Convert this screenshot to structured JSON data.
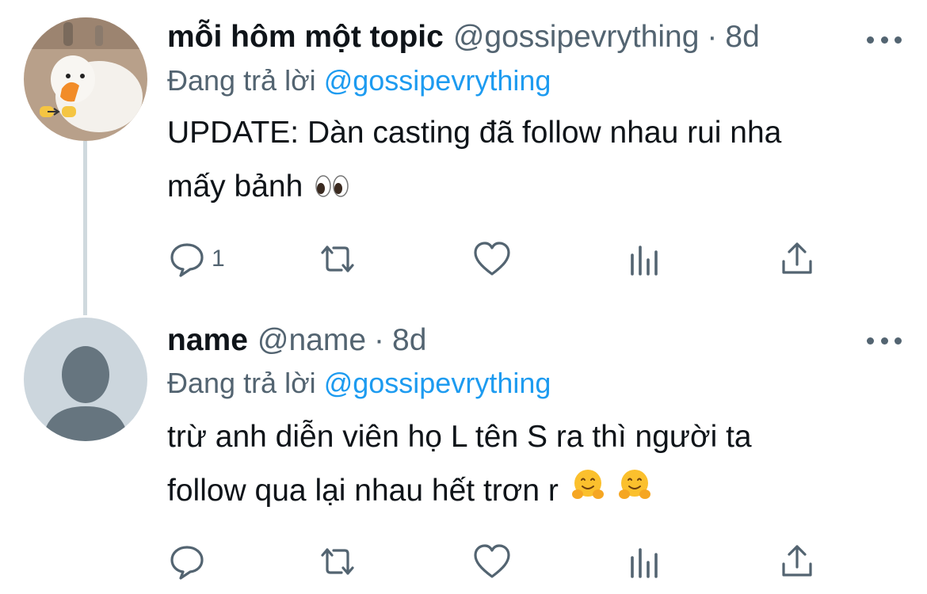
{
  "tweets": [
    {
      "display_name": "mỗi hôm một topic",
      "handle": "@gossipevrything",
      "separator": "·",
      "time": "8d",
      "replying_prefix": "Đang trả lời",
      "replying_to": "@gossipevrything",
      "text_line1": "UPDATE: Dàn casting đã follow nhau rui nha",
      "text_line2": "mấy bảnh",
      "text_emoji": "eyes",
      "reply_count": "1"
    },
    {
      "display_name": "name",
      "handle": "@name",
      "separator": "·",
      "time": "8d",
      "replying_prefix": "Đang trả lời",
      "replying_to": "@gossipevrything",
      "text_line1": "trừ anh diễn viên họ L tên S ra thì người ta",
      "text_line2": "follow qua lại nhau hết trơn r",
      "text_emoji": "hugging-face x2",
      "reply_count": ""
    }
  ],
  "icons": {
    "reply": "comment-bubble-icon",
    "retweet": "retweet-icon",
    "like": "heart-icon",
    "views": "analytics-bars-icon",
    "share": "share-upload-icon",
    "more": "more-dots-icon"
  },
  "colors": {
    "text": "#0f1419",
    "secondary": "#536471",
    "link": "#1d9bf0",
    "thread_line": "#cfd9de",
    "default_avatar_bg": "#ccd6dd",
    "default_avatar_fg": "#66757f"
  }
}
